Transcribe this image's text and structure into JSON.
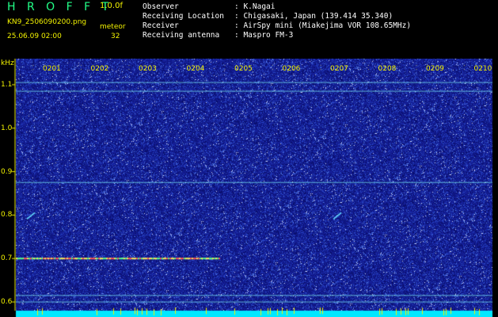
{
  "header": {
    "app_title": "H R O F F T",
    "version": "1.0.0f",
    "filename": "KN9_2506090200.png",
    "mode": "meteor",
    "datetime": "25.06.09 02:00",
    "count": "32",
    "fields": [
      {
        "key": "Observer",
        "value": ": K.Nagai"
      },
      {
        "key": "Receiving Location",
        "value": ": Chigasaki, Japan (139.414 35.340)"
      },
      {
        "key": "Receiver",
        "value": ": AirSpy mini (Miakejima VOR 108.65MHz)"
      },
      {
        "key": "Receiving antenna",
        "value": ": Maspro FM-3"
      }
    ]
  },
  "colors": {
    "background": "#000000",
    "label_yellow": "#f2f200",
    "title_green": "#22ff88",
    "noise_blue": "#1e2fa8",
    "signal_cyan": "#00ffff"
  },
  "chart_data": {
    "type": "heatmap",
    "ylabel": "kHz",
    "y_ticks": [
      "1.1",
      "1.0",
      "0.9",
      "0.8",
      "0.7",
      "0.6"
    ],
    "x_ticks": [
      "0201",
      "0202",
      "0203",
      "0204",
      "0205",
      "0206",
      "0207",
      "0208",
      "0209",
      "0210"
    ],
    "ylim": [
      0.58,
      1.16
    ],
    "horizontal_lines_khz": [
      1.105,
      1.085,
      0.875,
      0.615,
      0.6
    ],
    "tone_trace": {
      "freq_khz": 0.7,
      "x_start_min": 0.0,
      "x_end_min": 3.85
    },
    "meteor_echoes": [
      {
        "minute": 6.3,
        "freq_khz": 0.8
      },
      {
        "minute": -0.1,
        "freq_khz": 0.8
      }
    ]
  }
}
